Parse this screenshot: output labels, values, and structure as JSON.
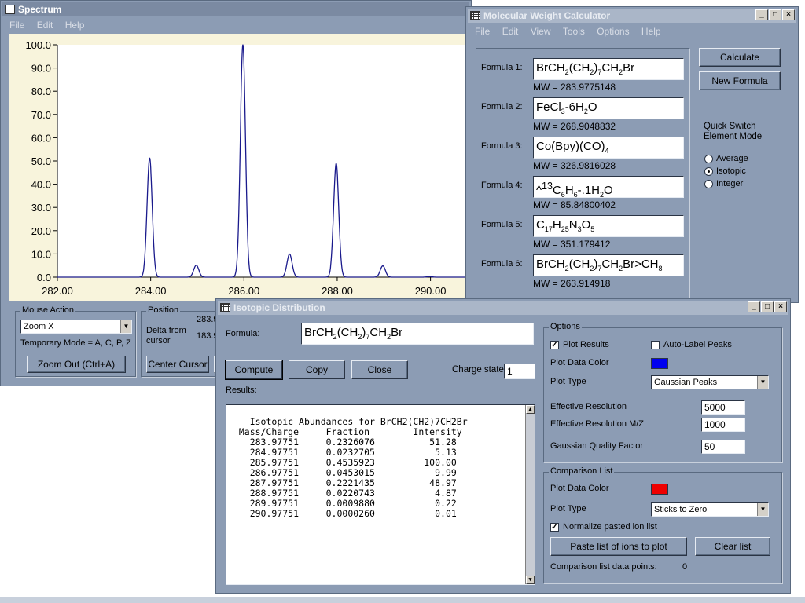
{
  "spectrum": {
    "title": "Spectrum",
    "menu": [
      "File",
      "Edit",
      "Help"
    ],
    "chart_data": {
      "type": "line",
      "xlim": [
        282,
        290.9
      ],
      "ylim": [
        0,
        100
      ],
      "x_ticks": [
        "282.00",
        "284.00",
        "286.00",
        "288.00",
        "290.00"
      ],
      "y_ticks": [
        "0.0",
        "10.0",
        "20.0",
        "30.0",
        "40.0",
        "50.0",
        "60.0",
        "70.0",
        "80.0",
        "90.0",
        "100.0"
      ],
      "series": [
        {
          "color": "#1a1a8c",
          "peaks": [
            {
              "x": 283.97751,
              "y": 51.28
            },
            {
              "x": 284.97751,
              "y": 5.13
            },
            {
              "x": 285.97751,
              "y": 100.0
            },
            {
              "x": 286.97751,
              "y": 9.99
            },
            {
              "x": 287.97751,
              "y": 48.97
            },
            {
              "x": 288.97751,
              "y": 4.87
            },
            {
              "x": 289.97751,
              "y": 0.22
            }
          ]
        }
      ],
      "grid": false
    },
    "mouse_action": {
      "group_label": "Mouse Action",
      "select_value": "Zoom X",
      "temp_mode": "Temporary Mode = A, C, P, Z",
      "zoom_out_label": "Zoom Out (Ctrl+A)"
    },
    "position": {
      "group_label": "Position",
      "value1": "283.9",
      "delta_label_1": "Delta from",
      "delta_label_2": "cursor",
      "value2": "183.9",
      "center_label": "Center Cursor"
    }
  },
  "mw_calc": {
    "title": "Molecular Weight Calculator",
    "menu": [
      "File",
      "Edit",
      "View",
      "Tools",
      "Options",
      "Help"
    ],
    "formulas": [
      {
        "label": "Formula 1:",
        "html": "BrCH<sub>2</sub>(CH<sub>2</sub>)<sub>7</sub>CH<sub>2</sub>Br",
        "mw": "MW = 283.9775148"
      },
      {
        "label": "Formula 2:",
        "html": "FeCl<sub>3</sub>-6H<sub>2</sub>O",
        "mw": "MW = 268.9048832"
      },
      {
        "label": "Formula 3:",
        "html": "Co(Bpy)(CO)<sub>4</sub>",
        "mw": "MW = 326.9816028"
      },
      {
        "label": "Formula 4:",
        "html": "^<sup>13</sup>C<sub>6</sub>H<sub>6</sub>-.1H<sub>2</sub>O",
        "mw": "MW = 85.84800402"
      },
      {
        "label": "Formula 5:",
        "html": "C<sub>17</sub>H<sub>25</sub>N<sub>3</sub>O<sub>5</sub>",
        "mw": "MW = 351.179412"
      },
      {
        "label": "Formula 6:",
        "html": "BrCH<sub>2</sub>(CH<sub>2</sub>)<sub>7</sub>CH<sub>2</sub>Br&gt;CH<sub>8</sub>",
        "mw": "MW = 263.914918"
      }
    ],
    "calculate_label": "Calculate",
    "new_formula_label": "New Formula",
    "quick_switch_1": "Quick Switch",
    "quick_switch_2": "Element Mode",
    "modes": [
      "Average",
      "Isotopic",
      "Integer"
    ],
    "selected_mode": "Isotopic"
  },
  "iso": {
    "title": "Isotopic Distribution",
    "formula_label": "Formula:",
    "formula_html": "BrCH<sub>2</sub>(CH<sub>2</sub>)<sub>7</sub>CH<sub>2</sub>Br",
    "compute_label": "Compute",
    "copy_label": "Copy",
    "close_label": "Close",
    "charge_label": "Charge state:",
    "charge_value": "1",
    "results_label": "Results:",
    "results_text": "Isotopic Abundances for BrCH2(CH2)7CH2Br\n  Mass/Charge     Fraction        Intensity\n    283.97751     0.2326076          51.28\n    284.97751     0.0232705           5.13\n    285.97751     0.4535923         100.00\n    286.97751     0.0453015           9.99\n    287.97751     0.2221435          48.97\n    288.97751     0.0220743           4.87\n    289.97751     0.0009880           0.22\n    290.97751     0.0000260           0.01",
    "options": {
      "group_label": "Options",
      "plot_results": "Plot Results",
      "plot_results_checked": true,
      "auto_label": "Auto-Label Peaks",
      "auto_label_checked": false,
      "plot_color_label": "Plot Data Color",
      "plot_color": "#0000ee",
      "plot_type_label": "Plot Type",
      "plot_type_value": "Gaussian Peaks",
      "eff_res_label": "Effective Resolution",
      "eff_res_value": "5000",
      "eff_res_mz_label": "Effective Resolution M/Z",
      "eff_res_mz_value": "1000",
      "gqf_label": "Gaussian Quality Factor",
      "gqf_value": "50"
    },
    "comparison": {
      "group_label": "Comparison List",
      "plot_color_label": "Plot Data Color",
      "plot_color": "#ee0000",
      "plot_type_label": "Plot Type",
      "plot_type_value": "Sticks to Zero",
      "normalize_label": "Normalize pasted ion list",
      "normalize_checked": true,
      "paste_label": "Paste list of ions to plot",
      "clear_label": "Clear list",
      "points_label": "Comparison list data points:",
      "points_value": "0"
    }
  }
}
